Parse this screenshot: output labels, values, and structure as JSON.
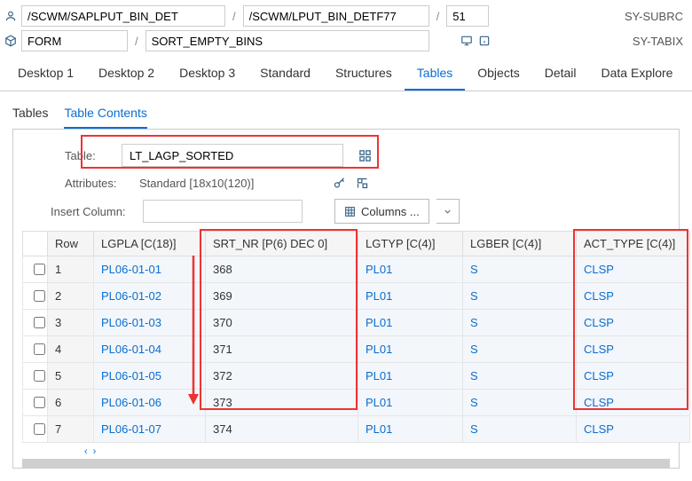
{
  "toolbar": {
    "path1": "/SCWM/SAPLPUT_BIN_DET",
    "path2": "/SCWM/LPUT_BIN_DETF77",
    "path3": "51",
    "sy_subrc": "SY-SUBRC",
    "form": "FORM",
    "subroutine": "SORT_EMPTY_BINS",
    "sy_tabix": "SY-TABIX"
  },
  "desktops": [
    "Desktop 1",
    "Desktop 2",
    "Desktop 3",
    "Standard",
    "Structures",
    "Tables",
    "Objects",
    "Detail",
    "Data Explore"
  ],
  "desktop_active": 5,
  "subtabs": [
    "Tables",
    "Table Contents"
  ],
  "subtab_active": 1,
  "table_section": {
    "table_label": "Table:",
    "table_name": "LT_LAGP_SORTED",
    "attributes_label": "Attributes:",
    "attributes_value": "Standard [18x10(120)]",
    "insert_label": "Insert Column:",
    "columns_btn": "Columns ..."
  },
  "grid": {
    "headers": [
      "Row",
      "LGPLA [C(18)]",
      "SRT_NR [P(6) DEC 0]",
      "LGTYP [C(4)]",
      "LGBER [C(4)]",
      "ACT_TYPE [C(4)]"
    ],
    "rows": [
      {
        "row": "1",
        "lgpla": "PL06-01-01",
        "srt": "368",
        "lgtyp": "PL01",
        "lgber": "S",
        "act": "CLSP"
      },
      {
        "row": "2",
        "lgpla": "PL06-01-02",
        "srt": "369",
        "lgtyp": "PL01",
        "lgber": "S",
        "act": "CLSP"
      },
      {
        "row": "3",
        "lgpla": "PL06-01-03",
        "srt": "370",
        "lgtyp": "PL01",
        "lgber": "S",
        "act": "CLSP"
      },
      {
        "row": "4",
        "lgpla": "PL06-01-04",
        "srt": "371",
        "lgtyp": "PL01",
        "lgber": "S",
        "act": "CLSP"
      },
      {
        "row": "5",
        "lgpla": "PL06-01-05",
        "srt": "372",
        "lgtyp": "PL01",
        "lgber": "S",
        "act": "CLSP"
      },
      {
        "row": "6",
        "lgpla": "PL06-01-06",
        "srt": "373",
        "lgtyp": "PL01",
        "lgber": "S",
        "act": "CLSP"
      },
      {
        "row": "7",
        "lgpla": "PL06-01-07",
        "srt": "374",
        "lgtyp": "PL01",
        "lgber": "S",
        "act": "CLSP"
      }
    ]
  }
}
